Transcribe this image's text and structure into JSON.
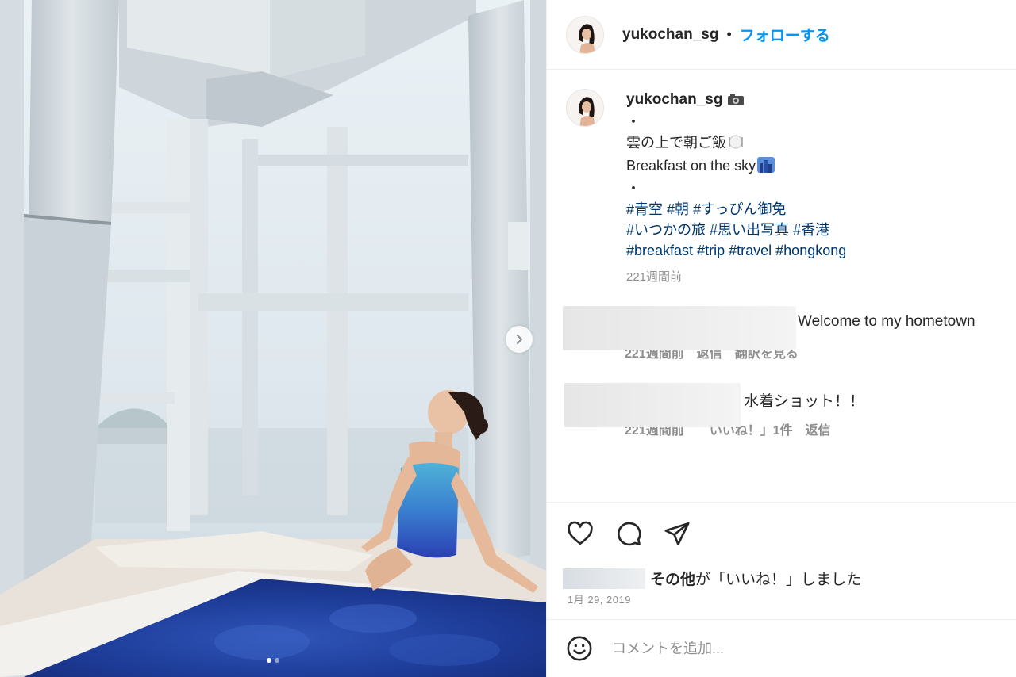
{
  "post": {
    "username": "yukochan_sg",
    "separator": "•",
    "follow_label": "フォローする"
  },
  "caption": {
    "username": "yukochan_sg",
    "camera_icon": "camera-icon",
    "line_dot_1": "・",
    "line_jp": "雲の上で朝ご飯",
    "line_en": "Breakfast on the sky",
    "line_dot_2": "・",
    "hashtags_row1": [
      "#青空",
      "#朝",
      "#すっぴん御免"
    ],
    "hashtags_row2": [
      "#いつかの旅",
      "#思い出写真",
      "#香港"
    ],
    "hashtags_row3": [
      "#breakfast",
      "#trip",
      "#travel",
      "#hongkong"
    ],
    "time": "221週間前"
  },
  "comments": [
    {
      "text": "Welcome to my hometown",
      "meta": "221週間前　返信　翻訳を見る"
    },
    {
      "text": "水着ショット！！",
      "meta": "221週間前　　いいね！」1件　返信"
    }
  ],
  "actions": {
    "like_icon": "heart-icon",
    "comment_icon": "comment-icon",
    "share_icon": "paper-plane-icon",
    "likes_bold": "その他",
    "likes_rest": "が「いいね！」しました",
    "date": "1月 29, 2019"
  },
  "add_comment": {
    "emoji_icon": "smiley-icon",
    "placeholder": "コメントを追加..."
  },
  "carousel": {
    "next_icon": "chevron-right-icon",
    "slide_count": 2,
    "active_index": 0
  }
}
